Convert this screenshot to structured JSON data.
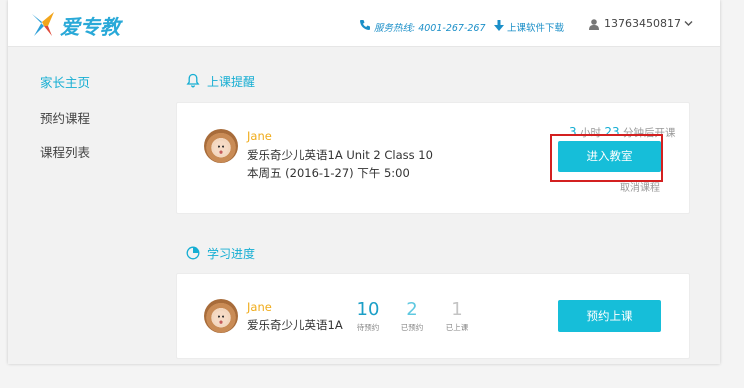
{
  "brand": {
    "name": "爱专教"
  },
  "header": {
    "hotline": "服务热线: 4001-267-267",
    "download": "上课软件下载",
    "username": "13763450817"
  },
  "sidebar": {
    "items": [
      {
        "label": "家长主页",
        "active": true
      },
      {
        "label": "预约课程",
        "active": false
      },
      {
        "label": "课程列表",
        "active": false
      }
    ]
  },
  "reminder": {
    "title": "上课提醒",
    "student": "Jane",
    "course": "爱乐奇少儿英语1A  Unit 2  Class 10",
    "time": "本周五 (2016-1-27) 下午 5:00",
    "countdown": {
      "hours": "3",
      "hours_unit": "小时",
      "minutes": "23",
      "minutes_suffix": "分钟后开课"
    },
    "enter_button": "进入教室",
    "cancel": "取消课程"
  },
  "progress": {
    "title": "学习进度",
    "student": "Jane",
    "course": "爱乐奇少儿英语1A",
    "stats": [
      {
        "value": "10",
        "label": "待预约",
        "color": "#1b9fc7"
      },
      {
        "value": "2",
        "label": "已预约",
        "color": "#5fc8e0"
      },
      {
        "value": "1",
        "label": "已上课",
        "color": "#c4c4c4"
      }
    ],
    "book_button": "预约上课"
  },
  "colors": {
    "accent": "#16aed3",
    "button": "#16bed9",
    "student_name": "#f0ac1c",
    "highlight": "#d32020"
  }
}
